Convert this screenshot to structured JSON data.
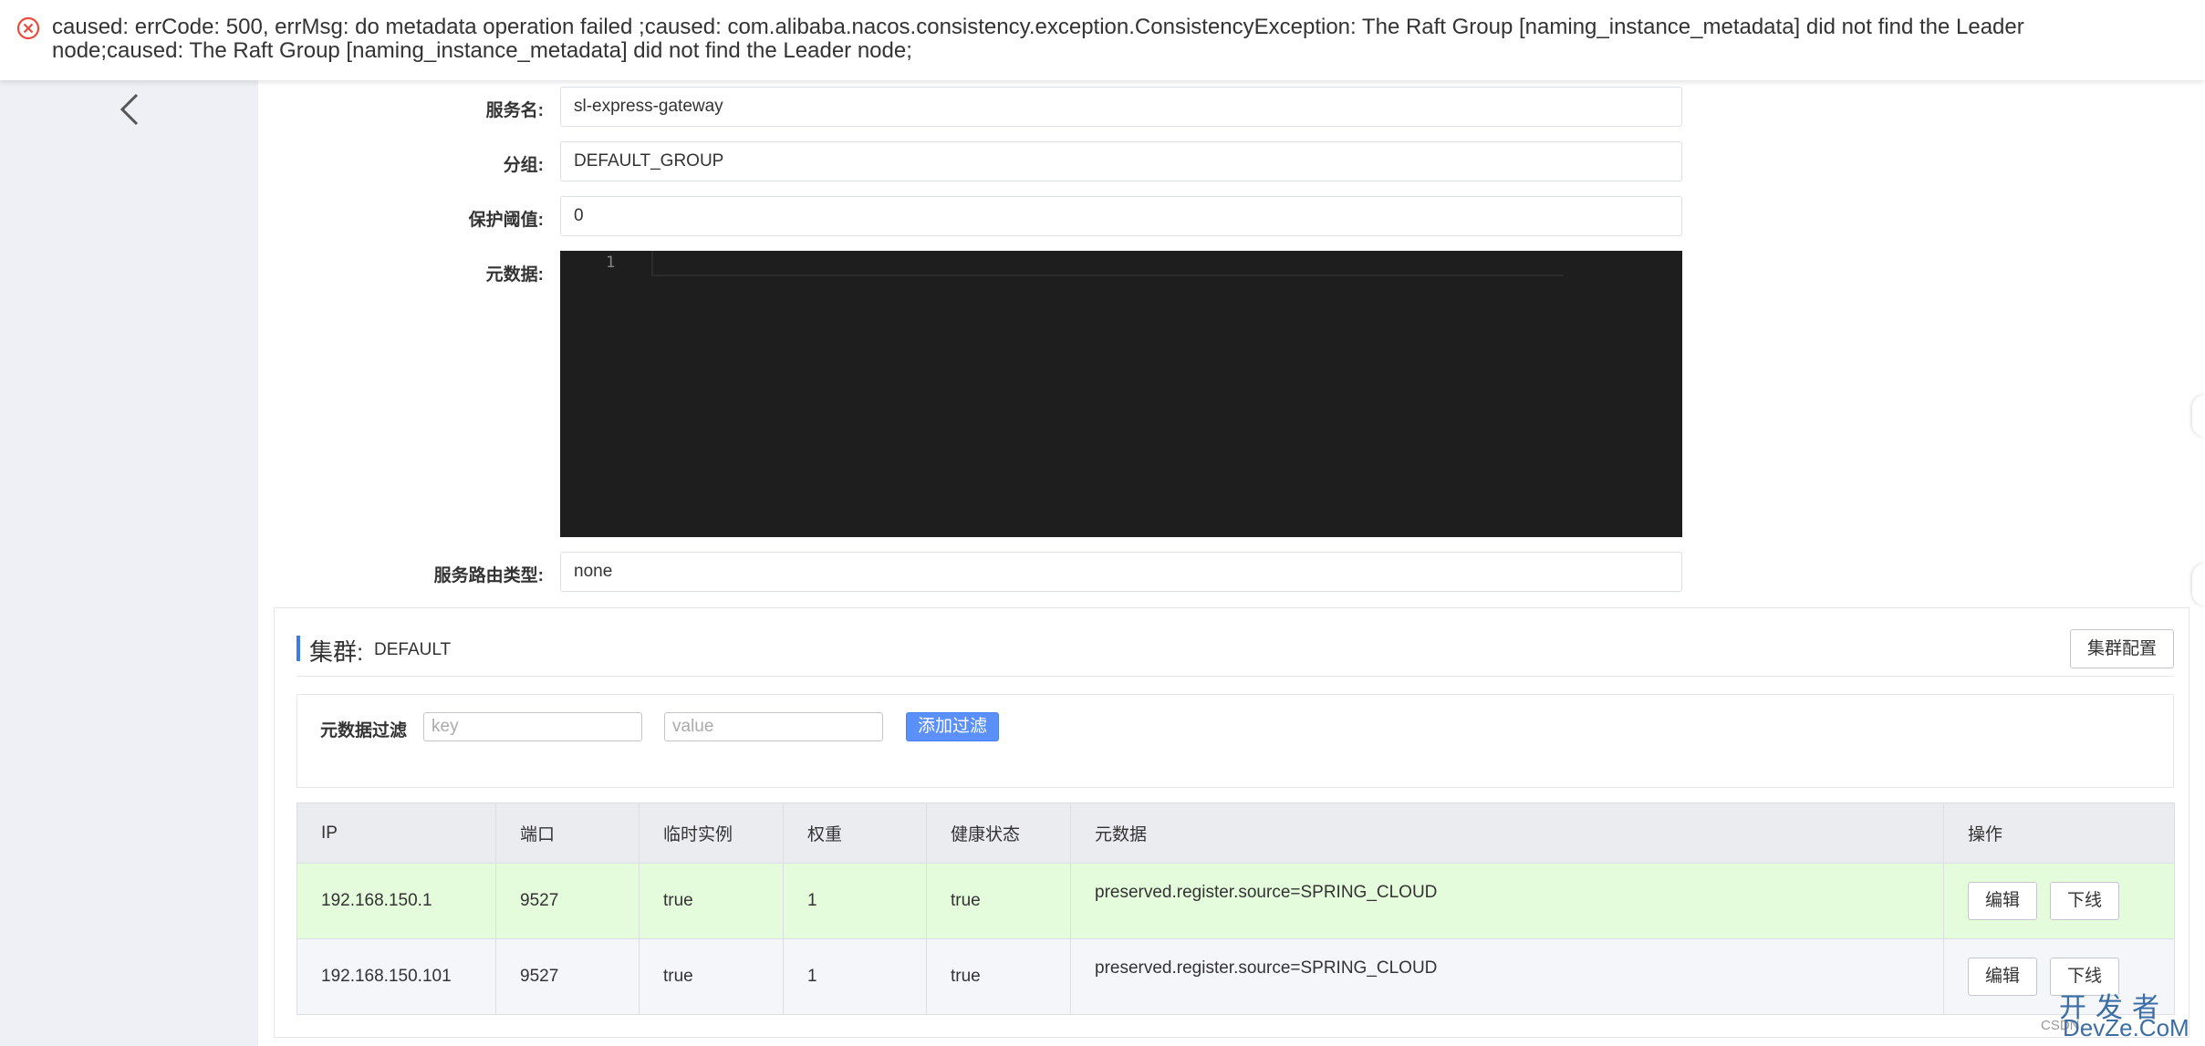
{
  "error": {
    "message": "caused: errCode: 500, errMsg: do metadata operation failed ;caused: com.alibaba.nacos.consistency.exception.ConsistencyException: The Raft Group [naming_instance_metadata] did not find the Leader node;caused: The Raft Group [naming_instance_metadata] did not find the Leader node;",
    "color": "#e84c3d"
  },
  "form": {
    "service_name_label": "服务名:",
    "service_name_value": "sl-express-gateway",
    "group_label": "分组:",
    "group_value": "DEFAULT_GROUP",
    "protect_threshold_label": "保护阈值:",
    "protect_threshold_value": "0",
    "metadata_label": "元数据:",
    "metadata_line_number": "1",
    "route_type_label": "服务路由类型:",
    "route_type_value": "none"
  },
  "cluster": {
    "title": "集群:",
    "name": "DEFAULT",
    "config_button": "集群配置",
    "filter_label": "元数据过滤",
    "key_placeholder": "key",
    "value_placeholder": "value",
    "add_filter_button": "添加过滤",
    "accent_color": "#3b7ce9"
  },
  "table": {
    "headers": [
      "IP",
      "端口",
      "临时实例",
      "权重",
      "健康状态",
      "元数据",
      "操作"
    ],
    "rows": [
      {
        "ip": "192.168.150.1",
        "port": "9527",
        "ephemeral": "true",
        "weight": "1",
        "healthy": "true",
        "metadata": "preserved.register.source=SPRING_CLOUD",
        "edit": "编辑",
        "offline": "下线"
      },
      {
        "ip": "192.168.150.101",
        "port": "9527",
        "ephemeral": "true",
        "weight": "1",
        "healthy": "true",
        "metadata": "preserved.register.source=SPRING_CLOUD",
        "edit": "编辑",
        "offline": "下线"
      }
    ]
  },
  "watermark": {
    "small": "CSDN",
    "chinese": "开发者",
    "english": "DevZe.CoM"
  }
}
